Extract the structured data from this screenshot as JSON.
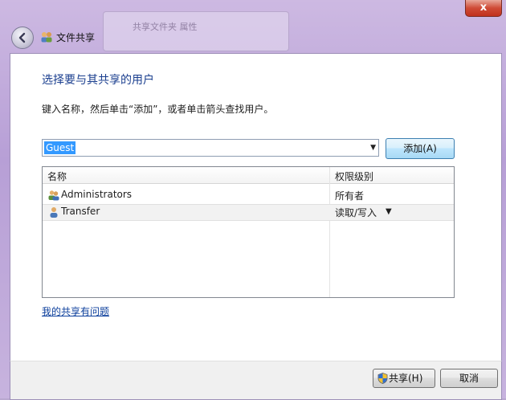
{
  "window": {
    "title": "文件共享",
    "close_label": "x",
    "ghost_title": "共享文件夹 属性"
  },
  "main": {
    "heading": "选择要与其共享的用户",
    "instruction": "键入名称，然后单击“添加”，或者单击箭头查找用户。",
    "combo_value": "Guest",
    "add_label": "添加(A)"
  },
  "table": {
    "columns": [
      "名称",
      "权限级别"
    ],
    "rows": [
      {
        "name": "Administrators",
        "permission": "所有者",
        "icon": "group-users-icon"
      },
      {
        "name": "Transfer",
        "permission": "读取/写入",
        "icon": "user-icon"
      }
    ]
  },
  "help_link": "我的共享有问题",
  "footer": {
    "share_label": "共享(H)",
    "cancel_label": "取消"
  },
  "colors": {
    "heading": "#1b3f8f",
    "selection": "#3399ff",
    "link": "#0c3f9c"
  }
}
